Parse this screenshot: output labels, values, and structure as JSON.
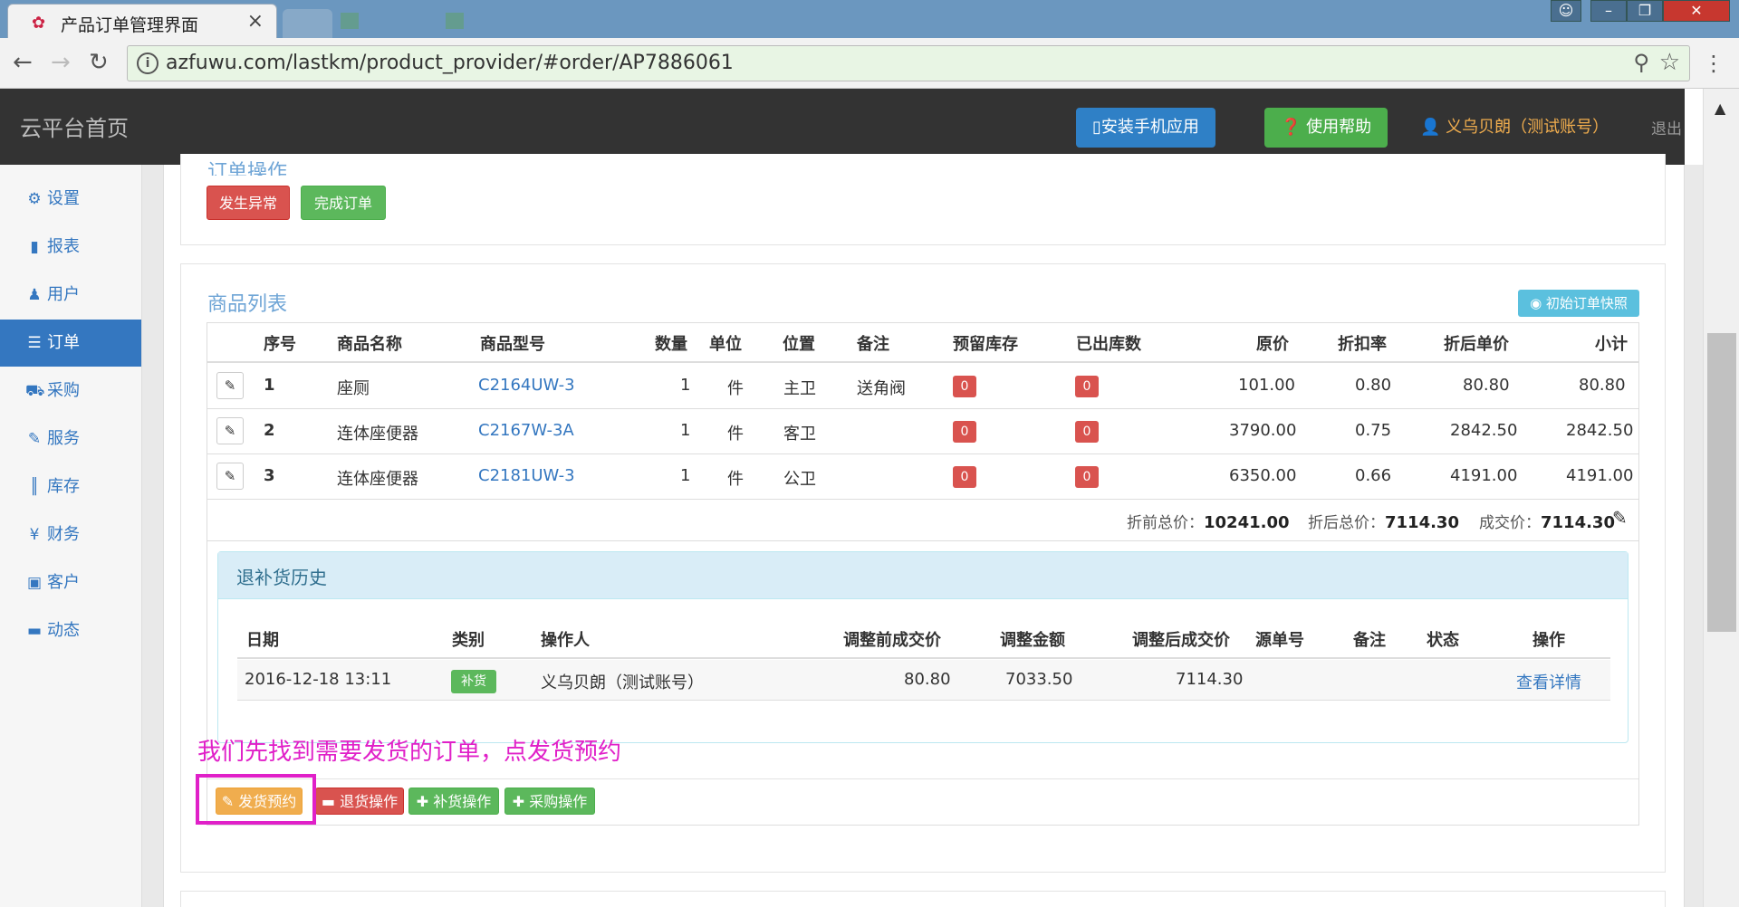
{
  "browser": {
    "tab_title": "产品订单管理界面",
    "url": "azfuwu.com/lastkm/product_provider/#order/AP7886061"
  },
  "header": {
    "brand": "云平台首页",
    "install_app": "安装手机应用",
    "help": "使用帮助",
    "user": "义乌贝朗（测试账号）",
    "logout": "退出"
  },
  "sidebar": {
    "items": [
      {
        "label": "设置",
        "icon": "gear-icon"
      },
      {
        "label": "报表",
        "icon": "bar-chart-icon"
      },
      {
        "label": "用户",
        "icon": "user-icon"
      },
      {
        "label": "订单",
        "icon": "list-icon"
      },
      {
        "label": "采购",
        "icon": "cart-icon"
      },
      {
        "label": "服务",
        "icon": "wrench-icon"
      },
      {
        "label": "库存",
        "icon": "barcode-icon"
      },
      {
        "label": "财务",
        "icon": "yen-icon"
      },
      {
        "label": "客户",
        "icon": "briefcase-icon"
      },
      {
        "label": "动态",
        "icon": "comment-icon"
      }
    ],
    "active": "订单"
  },
  "order_ops": {
    "title": "订单操作",
    "exception_btn": "发生异常",
    "complete_btn": "完成订单"
  },
  "product_list": {
    "title": "商品列表",
    "snapshot_btn": "初始订单快照",
    "columns": [
      "序号",
      "商品名称",
      "商品型号",
      "数量",
      "单位",
      "位置",
      "备注",
      "预留库存",
      "已出库数",
      "原价",
      "折扣率",
      "折后单价",
      "小计"
    ],
    "rows": [
      {
        "seq": "1",
        "name": "座厕",
        "model": "C2164UW-3",
        "qty": "1",
        "unit": "件",
        "location": "主卫",
        "note": "送角阀",
        "reserved": "0",
        "shipped": "0",
        "price": "101.00",
        "discount": "0.80",
        "unit_price": "80.80",
        "subtotal": "80.80"
      },
      {
        "seq": "2",
        "name": "连体座便器",
        "model": "C2167W-3A",
        "qty": "1",
        "unit": "件",
        "location": "客卫",
        "note": "",
        "reserved": "0",
        "shipped": "0",
        "price": "3790.00",
        "discount": "0.75",
        "unit_price": "2842.50",
        "subtotal": "2842.50"
      },
      {
        "seq": "3",
        "name": "连体座便器",
        "model": "C2181UW-3",
        "qty": "1",
        "unit": "件",
        "location": "公卫",
        "note": "",
        "reserved": "0",
        "shipped": "0",
        "price": "6350.00",
        "discount": "0.66",
        "unit_price": "4191.00",
        "subtotal": "4191.00"
      }
    ],
    "totals": {
      "before_label": "折前总价：",
      "before_value": "10241.00",
      "after_label": "折后总价：",
      "after_value": "7114.30",
      "deal_label": "成交价：",
      "deal_value": "7114.30"
    }
  },
  "history": {
    "title": "退补货历史",
    "columns": [
      "日期",
      "类别",
      "操作人",
      "调整前成交价",
      "调整金额",
      "调整后成交价",
      "源单号",
      "备注",
      "状态",
      "操作"
    ],
    "rows": [
      {
        "date": "2016-12-18 13:11",
        "type": "补货",
        "operator": "义乌贝朗（测试账号）",
        "before": "80.80",
        "amount": "7033.50",
        "after": "7114.30",
        "source": "",
        "note": "",
        "status": "",
        "action": "查看详情"
      }
    ]
  },
  "annotation": "我们先找到需要发货的订单，点发货预约",
  "actions": {
    "ship_reserve": "发货预约",
    "return": "退货操作",
    "restock": "补货操作",
    "purchase": "采购操作"
  }
}
